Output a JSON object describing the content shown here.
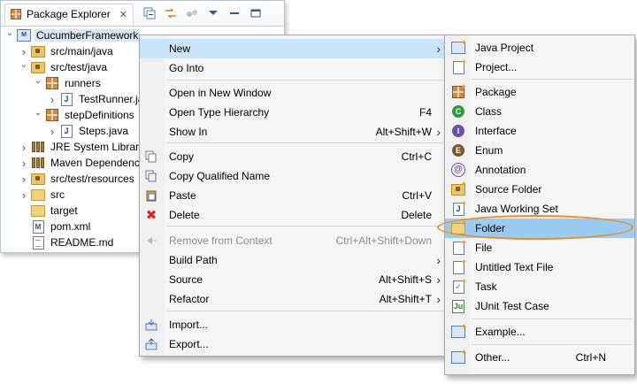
{
  "explorer": {
    "tab_label": "Package Explorer",
    "close_glyph": "✕",
    "tree": [
      {
        "label": "CucumberFramework",
        "depth": 0,
        "expanded": true,
        "icon": "project-icon",
        "selected": true
      },
      {
        "label": "src/main/java",
        "depth": 1,
        "expanded": false,
        "icon": "source-folder-icon"
      },
      {
        "label": "src/test/java",
        "depth": 1,
        "expanded": true,
        "icon": "source-folder-icon"
      },
      {
        "label": "runners",
        "depth": 2,
        "expanded": true,
        "icon": "package-icon"
      },
      {
        "label": "TestRunner.java",
        "depth": 3,
        "expanded": false,
        "icon": "java-file-icon"
      },
      {
        "label": "stepDefinitions",
        "depth": 2,
        "expanded": true,
        "icon": "package-icon"
      },
      {
        "label": "Steps.java",
        "depth": 3,
        "expanded": false,
        "icon": "java-file-icon"
      },
      {
        "label": "JRE System Library",
        "depth": 1,
        "expanded": false,
        "icon": "library-icon"
      },
      {
        "label": "Maven Dependencies",
        "depth": 1,
        "expanded": false,
        "icon": "library-icon"
      },
      {
        "label": "src/test/resources",
        "depth": 1,
        "expanded": false,
        "icon": "source-folder-icon"
      },
      {
        "label": "src",
        "depth": 1,
        "expanded": false,
        "icon": "folder-icon"
      },
      {
        "label": "target",
        "depth": 1,
        "expanded": null,
        "icon": "folder-icon"
      },
      {
        "label": "pom.xml",
        "depth": 1,
        "expanded": null,
        "icon": "xml-file-icon"
      },
      {
        "label": "README.md",
        "depth": 1,
        "expanded": null,
        "icon": "text-file-icon"
      }
    ]
  },
  "context_menu": {
    "items": [
      {
        "label": "New",
        "accel": "",
        "submenu": true,
        "highlight": true
      },
      {
        "label": "Go Into",
        "accel": ""
      },
      {
        "label": "Open in New Window",
        "accel": ""
      },
      {
        "label": "Open Type Hierarchy",
        "accel": "F4"
      },
      {
        "label": "Show In",
        "accel": "Alt+Shift+W",
        "submenu": true
      },
      {
        "label": "Copy",
        "accel": "Ctrl+C",
        "icon": "copy-icon"
      },
      {
        "label": "Copy Qualified Name",
        "accel": "",
        "icon": "copy-qualified-icon"
      },
      {
        "label": "Paste",
        "accel": "Ctrl+V",
        "icon": "paste-icon"
      },
      {
        "label": "Delete",
        "accel": "Delete",
        "icon": "delete-icon"
      },
      {
        "label": "Remove from Context",
        "accel": "Ctrl+Alt+Shift+Down",
        "disabled": true,
        "icon": "remove-context-icon"
      },
      {
        "label": "Build Path",
        "accel": "",
        "submenu": true
      },
      {
        "label": "Source",
        "accel": "Alt+Shift+S",
        "submenu": true
      },
      {
        "label": "Refactor",
        "accel": "Alt+Shift+T",
        "submenu": true
      },
      {
        "label": "Import...",
        "accel": "",
        "icon": "import-icon"
      },
      {
        "label": "Export...",
        "accel": "",
        "icon": "export-icon"
      }
    ]
  },
  "new_submenu": {
    "items": [
      {
        "label": "Java Project",
        "accel": ""
      },
      {
        "label": "Project...",
        "accel": ""
      },
      {
        "label": "Package",
        "accel": ""
      },
      {
        "label": "Class",
        "accel": ""
      },
      {
        "label": "Interface",
        "accel": ""
      },
      {
        "label": "Enum",
        "accel": ""
      },
      {
        "label": "Annotation",
        "accel": ""
      },
      {
        "label": "Source Folder",
        "accel": ""
      },
      {
        "label": "Java Working Set",
        "accel": ""
      },
      {
        "label": "Folder",
        "accel": "",
        "highlight": true
      },
      {
        "label": "File",
        "accel": ""
      },
      {
        "label": "Untitled Text File",
        "accel": ""
      },
      {
        "label": "Task",
        "accel": ""
      },
      {
        "label": "JUnit Test Case",
        "accel": ""
      },
      {
        "label": "Example...",
        "accel": ""
      },
      {
        "label": "Other...",
        "accel": "Ctrl+N"
      }
    ]
  },
  "colors": {
    "menu_highlight": "#cce4f7",
    "folder_highlight": "#9ccbf2",
    "callout": "#f08a24"
  },
  "glyphs": {
    "submenu_arrow": "›",
    "expanded": "⌄",
    "collapsed": "›",
    "class_letter": "C",
    "interface_letter": "I",
    "enum_letter": "E",
    "annotation_letter": "@",
    "junit_letter": "Ju",
    "java_letter": "J",
    "maven_letter": "M",
    "xml_letter": "M"
  }
}
